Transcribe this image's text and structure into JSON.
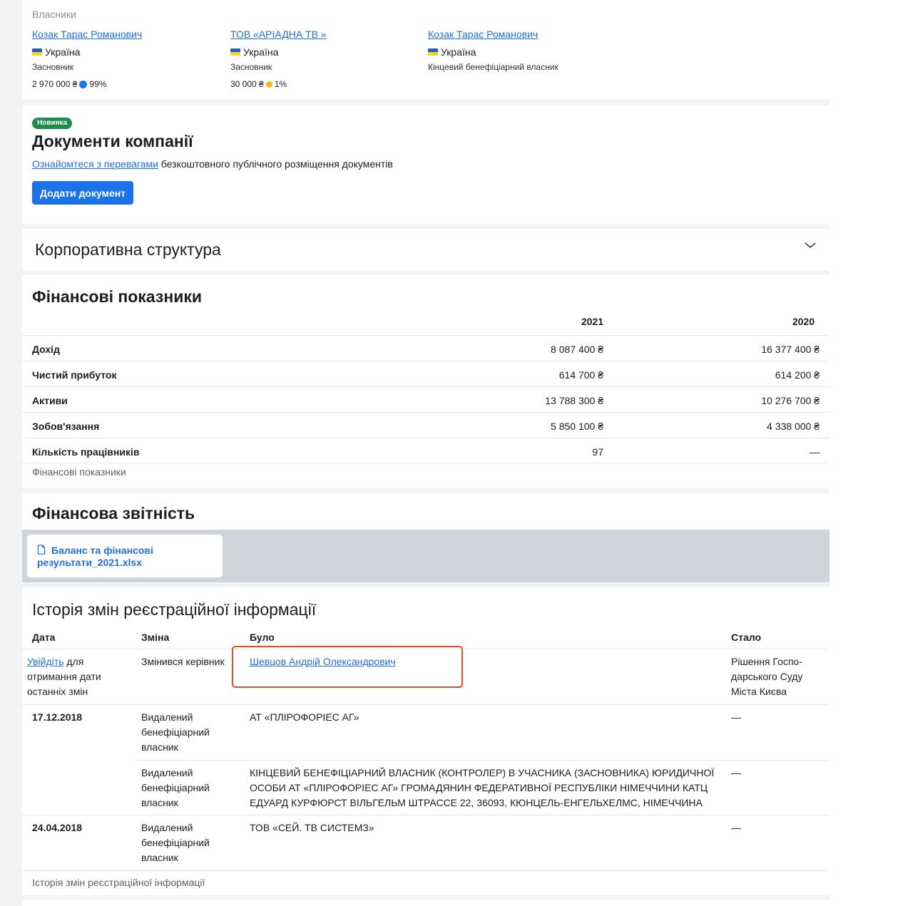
{
  "owners": {
    "title": "Власники",
    "items": [
      {
        "name": "Козак Тарас Романович",
        "country": "Україна",
        "role": "Засновник",
        "amount": "2 970 000 ₴",
        "percent": "99%",
        "dot_color": "#1a73e8"
      },
      {
        "name": "ТОВ «АРІАДНА ТВ »",
        "country": "Україна",
        "role": "Засновник",
        "amount": "30 000 ₴",
        "percent": "1%",
        "dot_color": "#f5b90f"
      },
      {
        "name": "Козак Тарас Романович",
        "country": "Україна",
        "role": "Кінцевий бенефіціарний власник"
      }
    ]
  },
  "documents": {
    "badge": "Новинка",
    "title": "Документи компанії",
    "link_text": "Ознайомтеся з перевагами",
    "text": " безкоштовного публічного розміщення документів",
    "button": "Додати документ"
  },
  "corporate": {
    "title": "Корпоративна структура",
    "toggle_icon": "chevron-down-icon"
  },
  "financials": {
    "title": "Фінансові показники",
    "years": [
      "2021",
      "2020"
    ],
    "rows": [
      {
        "label": "Дохід",
        "v2021": "8 087 400 ₴",
        "v2020": "16 377 400 ₴"
      },
      {
        "label": "Чистий прибуток",
        "v2021": "614 700 ₴",
        "v2020": "614 200 ₴"
      },
      {
        "label": "Активи",
        "v2021": "13 788 300 ₴",
        "v2020": "10 276 700 ₴"
      },
      {
        "label": "Зобов'язання",
        "v2021": "5 850 100 ₴",
        "v2020": "4 338 000 ₴"
      },
      {
        "label": "Кількість працівників",
        "v2021": "97",
        "v2020": "—"
      }
    ],
    "footer": "Фінансові показники"
  },
  "reports": {
    "title": "Фінансова звітність",
    "file_name": "Баланс та фінансові результати_2021.xlsx",
    "file_icon": "file-icon"
  },
  "history": {
    "title": "Історія змін реєстраційної інформації",
    "columns": {
      "date": "Дата",
      "change": "Зміна",
      "was": "Було",
      "became": "Стало"
    },
    "login_link": "Увійдіть",
    "login_text": " для отримання дати останніх змін",
    "rows": [
      {
        "date": "",
        "change": "Змінився керівник",
        "was": "Шевцов Андрій Олександрович",
        "became": "Рішення Госпо-дарського Суду Міста Києва"
      },
      {
        "date": "17.12.2018",
        "change": "Видалений бенефіціарний власник",
        "was": "АТ «ПЛІРОФОРІЕС АГ»",
        "became": "—"
      },
      {
        "date": "",
        "change": "Видалений бенефіціарний власник",
        "was": "КІНЦЕВИЙ БЕНЕФІЦІАРНИЙ ВЛАСНИК (КОНТРОЛЕР) В УЧАСНИКА (ЗАСНОВНИКА) ЮРИДИЧНОЇ ОСОБИ АТ «ПЛІРОФОРІЕС АГ» ГРОМАДЯНИН ФЕДЕРАТИВНОЇ РЕСПУБЛІКИ НІМЕЧЧИНИ КАТЦ ЕДУАРД КУРФЮРСТ ВІЛЬГЕЛЬМ ШТРАССЕ 22, 36093, КЮНЦЕЛЬ-ЕНГЕЛЬХЕЛМС, НІМЕЧЧИНА",
        "became": "—"
      },
      {
        "date": "24.04.2018",
        "change": "Видалений бенефіціарний власник",
        "was": "ТОВ «СЕЙ. ТВ СИСТЕМЗ»",
        "became": "—"
      }
    ],
    "footer": "Історія змін реєстраційної інформації"
  },
  "colors": {
    "accent": "#1a73e8",
    "badge": "#1e8a4c",
    "highlight": "#e0502a"
  }
}
